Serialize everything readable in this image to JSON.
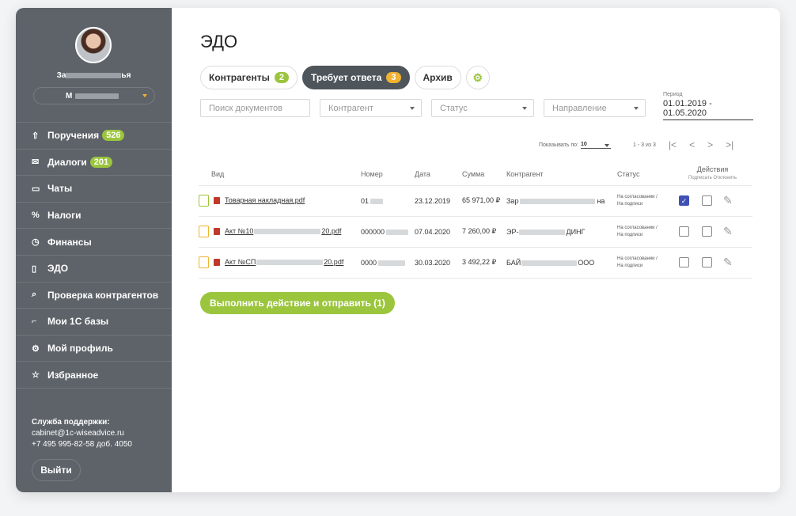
{
  "user": {
    "name_start": "За",
    "name_end": "ья",
    "org_initial": "М"
  },
  "nav": [
    {
      "icon": "⇧",
      "icon_name": "upload-icon",
      "label": "Поручения",
      "badge": "526"
    },
    {
      "icon": "✉",
      "icon_name": "mail-icon",
      "label": "Диалоги",
      "badge": "201"
    },
    {
      "icon": "▭",
      "icon_name": "chat-icon",
      "label": "Чаты",
      "badge": ""
    },
    {
      "icon": "%",
      "icon_name": "percent-icon",
      "label": "Налоги",
      "badge": ""
    },
    {
      "icon": "◷",
      "icon_name": "clock-icon",
      "label": "Финансы",
      "badge": ""
    },
    {
      "icon": "▯",
      "icon_name": "document-icon",
      "label": "ЭДО",
      "badge": ""
    },
    {
      "icon": "⌕",
      "icon_name": "search-icon",
      "label": "Проверка контрагентов",
      "badge": ""
    },
    {
      "icon": "⌐",
      "icon_name": "database-icon",
      "label": "Мои 1С базы",
      "badge": ""
    },
    {
      "icon": "⚙",
      "icon_name": "gear-icon",
      "label": "Мой профиль",
      "badge": ""
    },
    {
      "icon": "☆",
      "icon_name": "star-icon",
      "label": "Избранное",
      "badge": ""
    }
  ],
  "support": {
    "title": "Служба поддержки:",
    "email": "cabinet@1c-wiseadvice.ru",
    "phone": "+7 495 995-82-58 доб. 4050"
  },
  "logout_label": "Выйти",
  "page_title": "ЭДО",
  "tabs": [
    {
      "label": "Контрагенты",
      "count": "2"
    },
    {
      "label": "Требует ответа",
      "count": "3"
    },
    {
      "label": "Архив",
      "count": ""
    }
  ],
  "filters": {
    "search_placeholder": "Поиск документов",
    "counterparty": "Контрагент",
    "status": "Статус",
    "direction": "Направление"
  },
  "period": {
    "label": "Период",
    "value": "01.01.2019 - 01.05.2020"
  },
  "pager": {
    "show_label": "Показывать по:",
    "page_size": "10",
    "range": "1 - 3 из 3",
    "first": "|<",
    "prev": "<",
    "next": ">",
    "last": ">|"
  },
  "columns": {
    "type": "Вид",
    "number": "Номер",
    "date": "Дата",
    "sum": "Сумма",
    "counterparty": "Контрагент",
    "status": "Статус",
    "actions": "Действия",
    "sign": "Подписать",
    "reject": "Отклонить"
  },
  "rows": [
    {
      "icon_color": "green",
      "name_start": "Товарная накладная.pdf",
      "name_end": "",
      "number": "01",
      "date": "23.12.2019",
      "sum": "65 971,00 ₽",
      "cp_start": "Зар",
      "cp_end": "на",
      "status1": "На согласовании /",
      "status2": "На подписи",
      "sign_checked": true,
      "sign_mark": "✓"
    },
    {
      "icon_color": "orange",
      "name_start": "Акт №10",
      "name_end": "20.pdf",
      "number": "000000",
      "date": "07.04.2020",
      "sum": "7 260,00 ₽",
      "cp_start": "ЭР-",
      "cp_end": "ДИНГ",
      "status1": "На согласовании /",
      "status2": "На подписи",
      "sign_checked": false,
      "sign_mark": ""
    },
    {
      "icon_color": "orange",
      "name_start": "Акт №СП",
      "name_end": "20.pdf",
      "number": "0000",
      "date": "30.03.2020",
      "sum": "3 492,22 ₽",
      "cp_start": "БАЙ",
      "cp_end": "ООО",
      "status1": "На согласовании /",
      "status2": "На подписи",
      "sign_checked": false,
      "sign_mark": ""
    }
  ],
  "submit_label": "Выполнить действие и отправить (1)",
  "colors": {
    "sidebar": "#5d6369",
    "accent_green": "#9bc53d",
    "accent_orange": "#f0b232",
    "check_blue": "#3f51b5"
  }
}
